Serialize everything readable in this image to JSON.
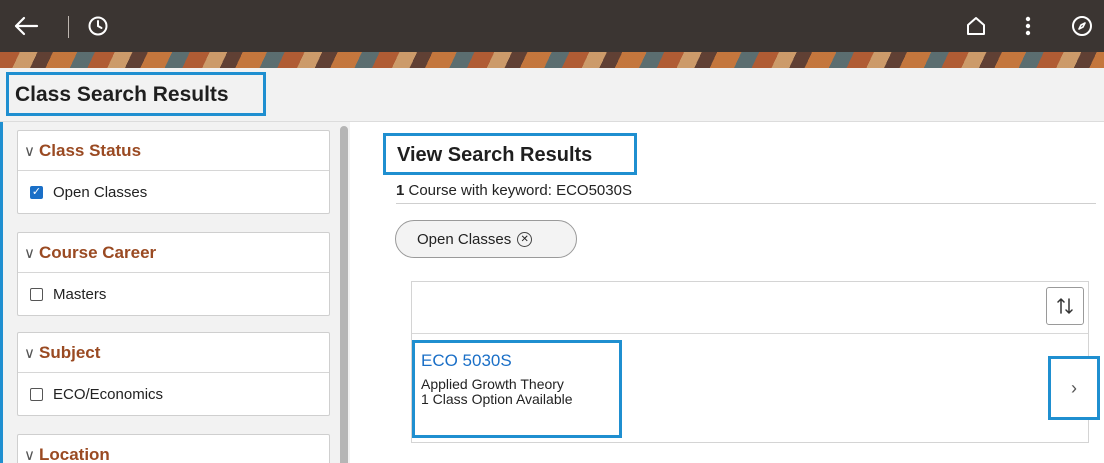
{
  "topbar": {
    "back_icon": "back-arrow-icon",
    "history_icon": "clock-icon",
    "home_icon": "home-icon",
    "more_icon": "more-vertical-icon",
    "navigator_icon": "compass-icon"
  },
  "page": {
    "title": "Class Search Results"
  },
  "filters": {
    "class_status": {
      "label": "Class Status",
      "option": "Open Classes",
      "checked": true
    },
    "course_career": {
      "label": "Course Career",
      "option": "Masters",
      "checked": false
    },
    "subject": {
      "label": "Subject",
      "option": "ECO/Economics",
      "checked": false
    },
    "location": {
      "label": "Location"
    }
  },
  "results": {
    "heading": "View Search Results",
    "count": "1",
    "summary_text": " Course with keyword: ECO5030S",
    "chip_label": "Open Classes",
    "course": {
      "code": "ECO 5030S",
      "title": "Applied Growth Theory",
      "options": "1 Class Option Available"
    }
  },
  "colors": {
    "accent_outline": "#1f8fd0",
    "link_blue": "#1a6fc7",
    "filter_heading": "#9a4a22",
    "topbar": "#3b3532"
  }
}
